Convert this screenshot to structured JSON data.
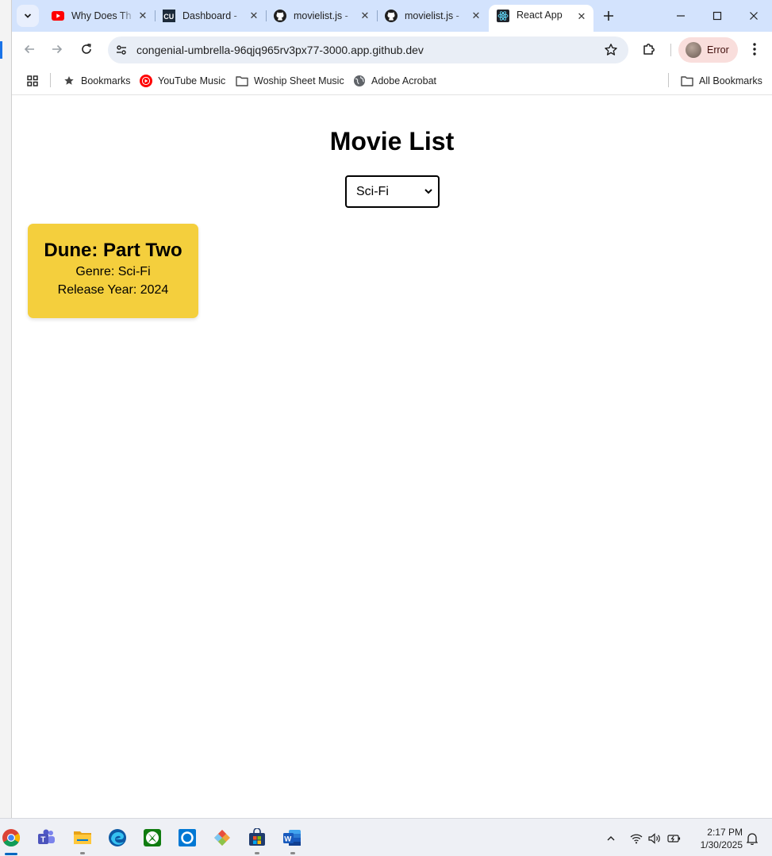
{
  "browser": {
    "tabs": [
      {
        "title": "Why Does Th",
        "favicon": "youtube-icon"
      },
      {
        "title": "Dashboard -",
        "favicon": "cu-logo-icon"
      },
      {
        "title": "movielist.js -",
        "favicon": "github-icon"
      },
      {
        "title": "movielist.js -",
        "favicon": "github-icon"
      },
      {
        "title": "React App",
        "favicon": "react-icon",
        "active": true
      }
    ],
    "url": "congenial-umbrella-96qjq965rv3px77-3000.app.github.dev",
    "profile_label": "Error",
    "bookmarks": [
      {
        "label": "Bookmarks",
        "icon": "star-icon"
      },
      {
        "label": "YouTube Music",
        "icon": "youtube-music-icon"
      },
      {
        "label": "Woship Sheet Music",
        "icon": "folder-icon"
      },
      {
        "label": "Adobe Acrobat",
        "icon": "globe-icon"
      }
    ],
    "all_bookmarks_label": "All Bookmarks"
  },
  "app": {
    "title": "Movie List",
    "genre_filter": {
      "selected": "Sci-Fi"
    },
    "movies": [
      {
        "title": "Dune: Part Two",
        "genre_line": "Genre: Sci-Fi",
        "year_line": "Release Year: 2024"
      }
    ]
  },
  "taskbar": {
    "apps": [
      "chrome-icon",
      "teams-icon",
      "file-explorer-icon",
      "edge-icon",
      "xbox-icon",
      "cortana-icon",
      "git-icon",
      "store-icon",
      "word-icon"
    ],
    "time": "2:17 PM",
    "date": "1/30/2025"
  },
  "colors": {
    "card": "#f4cf3d",
    "tabstrip": "#d3e3fd",
    "omnibox": "#e9eef6",
    "profile_chip": "#f9dedc"
  }
}
